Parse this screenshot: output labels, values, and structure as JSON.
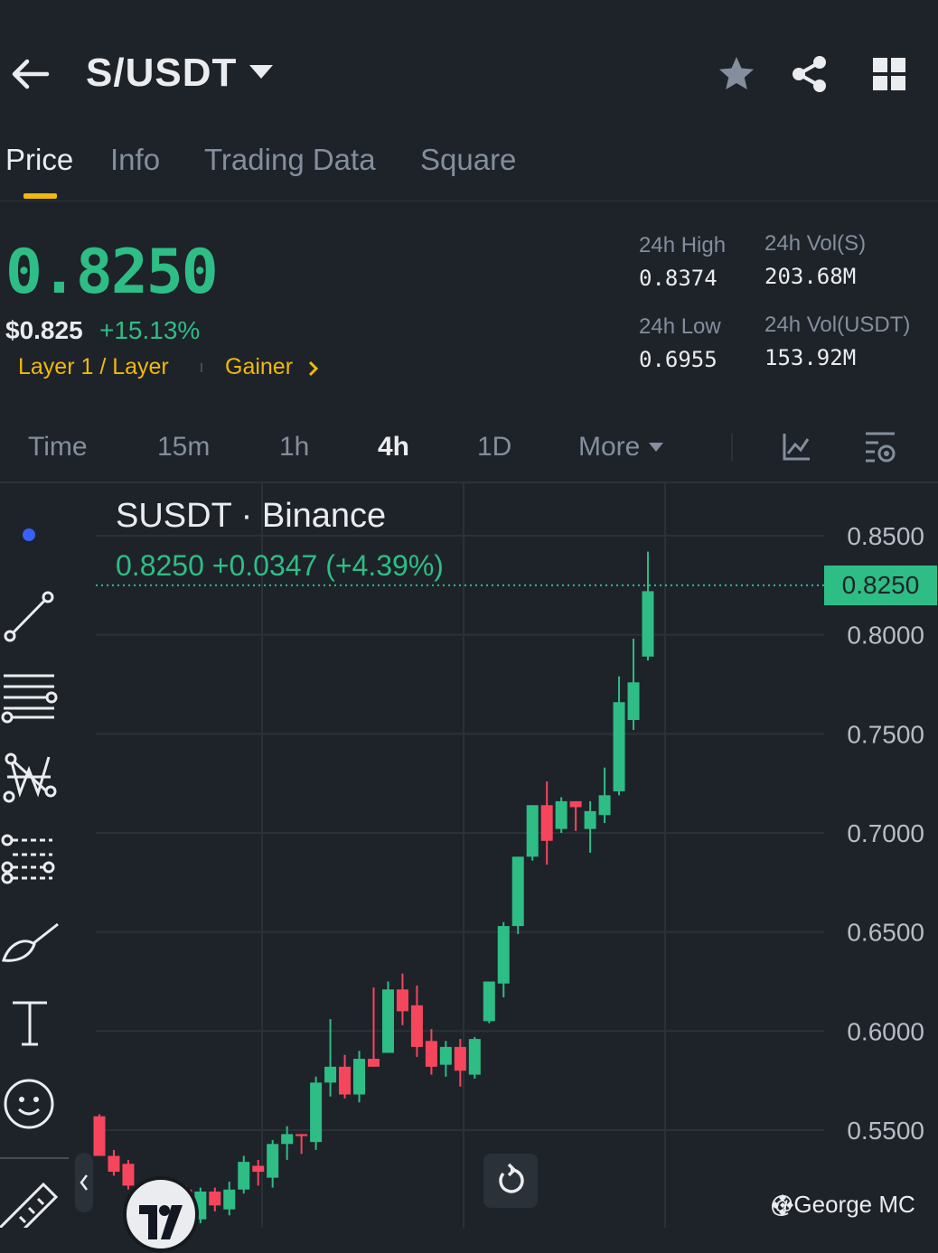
{
  "header": {
    "title": "S/USDT"
  },
  "tabs": [
    {
      "label": "Price",
      "active": true
    },
    {
      "label": "Info",
      "active": false
    },
    {
      "label": "Trading Data",
      "active": false
    },
    {
      "label": "Square",
      "active": false
    }
  ],
  "price": {
    "last": "0.8250",
    "usd": "$0.825",
    "change_pct": "+15.13%",
    "tag_category": "Layer 1 / Layer",
    "tag_gainer": "Gainer"
  },
  "stats": {
    "high_label": "24h High",
    "high_value": "0.8374",
    "low_label": "24h Low",
    "low_value": "0.6955",
    "vol_base_label": "24h Vol(S)",
    "vol_base_value": "203.68M",
    "vol_quote_label": "24h Vol(USDT)",
    "vol_quote_value": "153.92M"
  },
  "intervals": [
    {
      "label": "Time",
      "active": false
    },
    {
      "label": "15m",
      "active": false
    },
    {
      "label": "1h",
      "active": false
    },
    {
      "label": "4h",
      "active": true
    },
    {
      "label": "1D",
      "active": false
    },
    {
      "label": "More",
      "active": false
    }
  ],
  "chart_legend": {
    "title": "SUSDT · Binance",
    "values": "0.8250  +0.0347 (+4.39%)"
  },
  "price_tag": "0.8250",
  "watermark": "@George MC",
  "colors": {
    "background": "#1e2329",
    "up": "#2ebd85",
    "down": "#f6465d",
    "accent": "#f0b90b",
    "muted": "#848e9c"
  },
  "chart_data": {
    "type": "candlestick",
    "y_ticks": [
      "0.8500",
      "0.8250",
      "0.8000",
      "0.7500",
      "0.7000",
      "0.6500",
      "0.6000",
      "0.5500"
    ],
    "ylim": [
      0.5,
      0.855
    ],
    "last_price": 0.825,
    "candles": [
      {
        "o": 0.557,
        "h": 0.558,
        "l": 0.537,
        "c": 0.537
      },
      {
        "o": 0.537,
        "h": 0.54,
        "l": 0.527,
        "c": 0.529
      },
      {
        "o": 0.533,
        "h": 0.535,
        "l": 0.52,
        "c": 0.522
      },
      {
        "o": 0.522,
        "h": 0.524,
        "l": 0.512,
        "c": 0.515
      },
      {
        "o": 0.515,
        "h": 0.519,
        "l": 0.506,
        "c": 0.508
      },
      {
        "o": 0.508,
        "h": 0.515,
        "l": 0.501,
        "c": 0.504
      },
      {
        "o": 0.52,
        "h": 0.522,
        "l": 0.505,
        "c": 0.508
      },
      {
        "o": 0.505,
        "h": 0.521,
        "l": 0.503,
        "c": 0.519
      },
      {
        "o": 0.519,
        "h": 0.521,
        "l": 0.509,
        "c": 0.512
      },
      {
        "o": 0.51,
        "h": 0.524,
        "l": 0.507,
        "c": 0.52
      },
      {
        "o": 0.52,
        "h": 0.537,
        "l": 0.518,
        "c": 0.534
      },
      {
        "o": 0.532,
        "h": 0.535,
        "l": 0.522,
        "c": 0.529
      },
      {
        "o": 0.526,
        "h": 0.545,
        "l": 0.521,
        "c": 0.543
      },
      {
        "o": 0.543,
        "h": 0.552,
        "l": 0.535,
        "c": 0.548
      },
      {
        "o": 0.548,
        "h": 0.543,
        "l": 0.538,
        "c": 0.547
      },
      {
        "o": 0.544,
        "h": 0.577,
        "l": 0.54,
        "c": 0.574
      },
      {
        "o": 0.574,
        "h": 0.606,
        "l": 0.567,
        "c": 0.582
      },
      {
        "o": 0.582,
        "h": 0.588,
        "l": 0.566,
        "c": 0.568
      },
      {
        "o": 0.568,
        "h": 0.59,
        "l": 0.564,
        "c": 0.586
      },
      {
        "o": 0.586,
        "h": 0.622,
        "l": 0.582,
        "c": 0.582
      },
      {
        "o": 0.589,
        "h": 0.625,
        "l": 0.589,
        "c": 0.621
      },
      {
        "o": 0.621,
        "h": 0.629,
        "l": 0.603,
        "c": 0.61
      },
      {
        "o": 0.613,
        "h": 0.623,
        "l": 0.587,
        "c": 0.592
      },
      {
        "o": 0.595,
        "h": 0.601,
        "l": 0.578,
        "c": 0.582
      },
      {
        "o": 0.583,
        "h": 0.595,
        "l": 0.577,
        "c": 0.592
      },
      {
        "o": 0.592,
        "h": 0.596,
        "l": 0.572,
        "c": 0.58
      },
      {
        "o": 0.578,
        "h": 0.597,
        "l": 0.576,
        "c": 0.596
      },
      {
        "o": 0.605,
        "h": 0.625,
        "l": 0.604,
        "c": 0.625
      },
      {
        "o": 0.624,
        "h": 0.655,
        "l": 0.617,
        "c": 0.653
      },
      {
        "o": 0.653,
        "h": 0.678,
        "l": 0.649,
        "c": 0.688
      },
      {
        "o": 0.688,
        "h": 0.705,
        "l": 0.686,
        "c": 0.714
      },
      {
        "o": 0.714,
        "h": 0.726,
        "l": 0.684,
        "c": 0.696
      },
      {
        "o": 0.702,
        "h": 0.718,
        "l": 0.7,
        "c": 0.716
      },
      {
        "o": 0.716,
        "h": 0.712,
        "l": 0.701,
        "c": 0.713
      },
      {
        "o": 0.702,
        "h": 0.716,
        "l": 0.69,
        "c": 0.711
      },
      {
        "o": 0.709,
        "h": 0.733,
        "l": 0.705,
        "c": 0.719
      },
      {
        "o": 0.721,
        "h": 0.779,
        "l": 0.719,
        "c": 0.766
      },
      {
        "o": 0.757,
        "h": 0.798,
        "l": 0.752,
        "c": 0.776
      },
      {
        "o": 0.789,
        "h": 0.842,
        "l": 0.787,
        "c": 0.822
      }
    ]
  }
}
